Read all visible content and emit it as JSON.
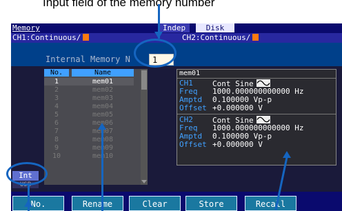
{
  "annotation": {
    "text": "Input field of the memory number"
  },
  "window": {
    "title": "Memory",
    "tab_indep": "Indep",
    "tab_disk": "Disk"
  },
  "channels": {
    "ch1": "CH1:Continuous/",
    "ch2": "CH2:Continuous/"
  },
  "memory_label": "Internal Memory N",
  "memory_number": "1",
  "table": {
    "headers": [
      "No.",
      "Name"
    ],
    "rows": [
      {
        "no": "1",
        "name": "mem01"
      },
      {
        "no": "2",
        "name": "mem02"
      },
      {
        "no": "3",
        "name": "mem03"
      },
      {
        "no": "4",
        "name": "mem04"
      },
      {
        "no": "5",
        "name": "mem05"
      },
      {
        "no": "6",
        "name": "mem06"
      },
      {
        "no": "7",
        "name": "mem07"
      },
      {
        "no": "8",
        "name": "mem08"
      },
      {
        "no": "9",
        "name": "mem09"
      },
      {
        "no": "10",
        "name": "mem10"
      }
    ]
  },
  "detail": {
    "name": "mem01",
    "ch1": {
      "label": "CH1",
      "wave": "Cont Sine",
      "freq_label": "Freq",
      "freq": "1000.000000000000 Hz",
      "amptd_label": "Amptd",
      "amptd": "0.100000 Vp-p",
      "offset_label": "Offset",
      "offset": "+0.000000 V"
    },
    "ch2": {
      "label": "CH2",
      "wave": "Cont Sine",
      "freq_label": "Freq",
      "freq": "1000.000000000000 Hz",
      "amptd_label": "Amptd",
      "amptd": "0.100000 Vp-p",
      "offset_label": "Offset",
      "offset": "+0.000000 V"
    }
  },
  "side": {
    "int": "Int",
    "ext": "USB"
  },
  "softkeys": [
    "No.",
    "Rename",
    "Clear",
    "Store",
    "Recall"
  ],
  "colors": {
    "callout": "#1565c0",
    "screen_bg": "#0a0a6e",
    "accent": "#40a0ff",
    "orange": "#ff7a10"
  }
}
